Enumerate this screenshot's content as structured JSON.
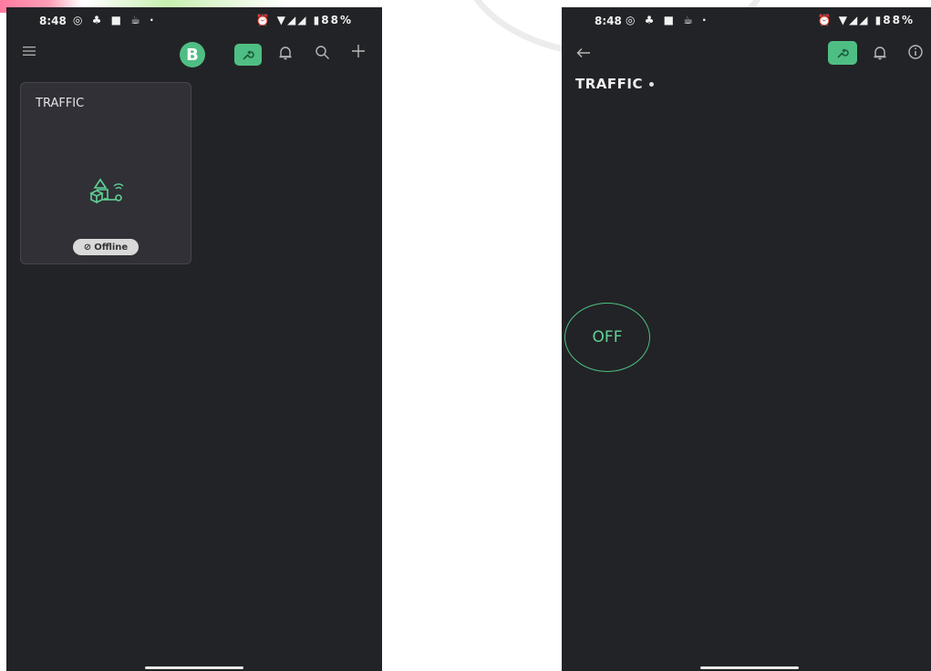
{
  "left_screen": {
    "status_bar": {
      "time": "8:48",
      "battery": "88%"
    },
    "app_bar": {
      "menu_icon": "menu-icon",
      "avatar_letter": "B",
      "wrench_icon": "wrench-icon",
      "bell_icon": "bell-icon",
      "search_icon": "search-icon",
      "add_icon": "plus-icon"
    },
    "device_card": {
      "title": "TRAFFIC",
      "status": "Offline"
    }
  },
  "right_screen": {
    "status_bar": {
      "time": "8:48",
      "battery": "88%"
    },
    "app_bar": {
      "back_icon": "back-arrow-icon",
      "wrench_icon": "wrench-icon",
      "bell_icon": "bell-icon",
      "info_icon": "info-icon"
    },
    "device_title": "TRAFFIC",
    "switch_button": {
      "label": "OFF"
    }
  },
  "colors": {
    "accent": "#4fbe84",
    "background": "#222326",
    "card": "#303036"
  }
}
